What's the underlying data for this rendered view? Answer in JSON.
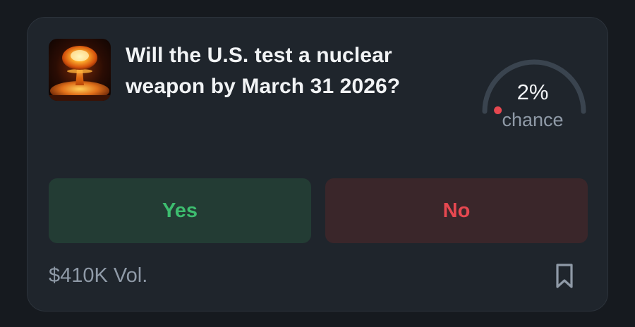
{
  "market": {
    "title": "Will the U.S. test a nuclear weapon by March 31 2026?",
    "thumbnail_icon": "nuclear-explosion-image",
    "chance": {
      "value": 2,
      "display": "2%",
      "label": "chance",
      "indicator_color": "#e64850"
    },
    "buttons": {
      "yes_label": "Yes",
      "no_label": "No"
    },
    "volume": "$410K Vol.",
    "bookmark_icon": "bookmark-icon"
  },
  "colors": {
    "background": "#161a1f",
    "card": "#1f252c",
    "yes_bg": "#233c34",
    "yes_text": "#3dbd6f",
    "no_bg": "#3a262a",
    "no_text": "#e64850",
    "muted_text": "#8f9aa7",
    "gauge_track": "#3a444f"
  }
}
